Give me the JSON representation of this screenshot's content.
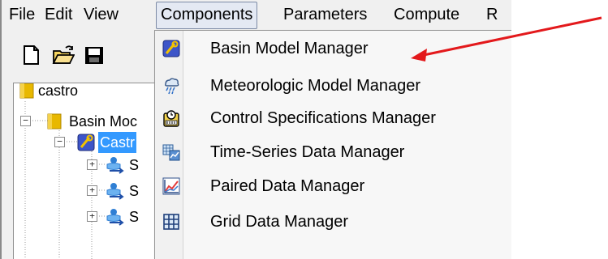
{
  "menubar": {
    "items": [
      "File",
      "Edit",
      "View",
      "Components",
      "Parameters",
      "Compute",
      "R"
    ]
  },
  "tree": {
    "root": "castro",
    "basin_folder": "Basin Moc",
    "model": "Castr",
    "subbasins": [
      "S",
      "S",
      "S"
    ]
  },
  "components_menu": {
    "items": [
      {
        "label": "Basin Model Manager",
        "icon": "basin-model-icon"
      },
      {
        "label": "Meteorologic Model Manager",
        "icon": "meteorologic-icon"
      },
      {
        "label": "Control Specifications Manager",
        "icon": "control-spec-icon"
      },
      {
        "label": "Time-Series Data Manager",
        "icon": "time-series-icon"
      },
      {
        "label": "Paired Data Manager",
        "icon": "paired-data-icon"
      },
      {
        "label": "Grid Data Manager",
        "icon": "grid-data-icon"
      }
    ]
  },
  "colors": {
    "arrow": "#e3191c",
    "selection": "#3399ff",
    "folder": "#e8b800"
  }
}
